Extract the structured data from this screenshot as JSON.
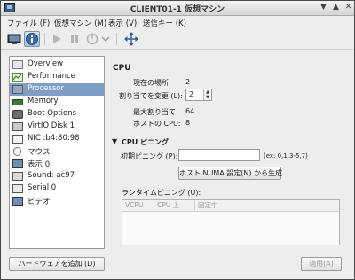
{
  "window": {
    "title": "CLIENT01-1 仮想マシン"
  },
  "menubar": {
    "items": [
      "ファイル (F)",
      "仮想マシン (M)",
      "表示 (V)",
      "送信キー (K)"
    ]
  },
  "sidebar": {
    "items": [
      {
        "label": "Overview",
        "icon": "overview-icon"
      },
      {
        "label": "Performance",
        "icon": "performance-icon"
      },
      {
        "label": "Processor",
        "icon": "processor-icon"
      },
      {
        "label": "Memory",
        "icon": "memory-icon"
      },
      {
        "label": "Boot Options",
        "icon": "boot-options-icon"
      },
      {
        "label": "VirtIO Disk 1",
        "icon": "disk-icon"
      },
      {
        "label": "NIC :b4:80:98",
        "icon": "nic-icon"
      },
      {
        "label": "マウス",
        "icon": "mouse-icon"
      },
      {
        "label": "表示 0",
        "icon": "display-icon"
      },
      {
        "label": "Sound: ac97",
        "icon": "sound-icon"
      },
      {
        "label": "Serial 0",
        "icon": "serial-icon"
      },
      {
        "label": "ビデオ",
        "icon": "video-icon"
      }
    ],
    "selected_index": 2,
    "add_hardware_label": "ハードウェアを追加 (D)"
  },
  "cpu": {
    "heading": "CPU",
    "current_alloc_label": "現在の場所:",
    "current_alloc_value": "2",
    "change_alloc_label": "割り当てを変更 (L):",
    "change_alloc_value": "2",
    "max_alloc_label": "最大割り当て:",
    "max_alloc_value": "64",
    "host_cpu_label": "ホストの CPU:",
    "host_cpu_value": "8"
  },
  "pinning": {
    "heading": "CPU ピニング",
    "default_label": "初期ピニング (P):",
    "default_value": "",
    "hint": "(ex: 0,1,3-5,7)",
    "generate_button": "ホスト NUMA 設定(N) から生成",
    "runtime_label": "ランタイムピニング (U):",
    "columns": [
      "VCPU",
      "CPU 上",
      "固定中"
    ]
  },
  "footer": {
    "apply_label": "適用(A)"
  },
  "colors": {
    "selection": "#7e9ec5",
    "titlebar": "#dcdcdc"
  }
}
